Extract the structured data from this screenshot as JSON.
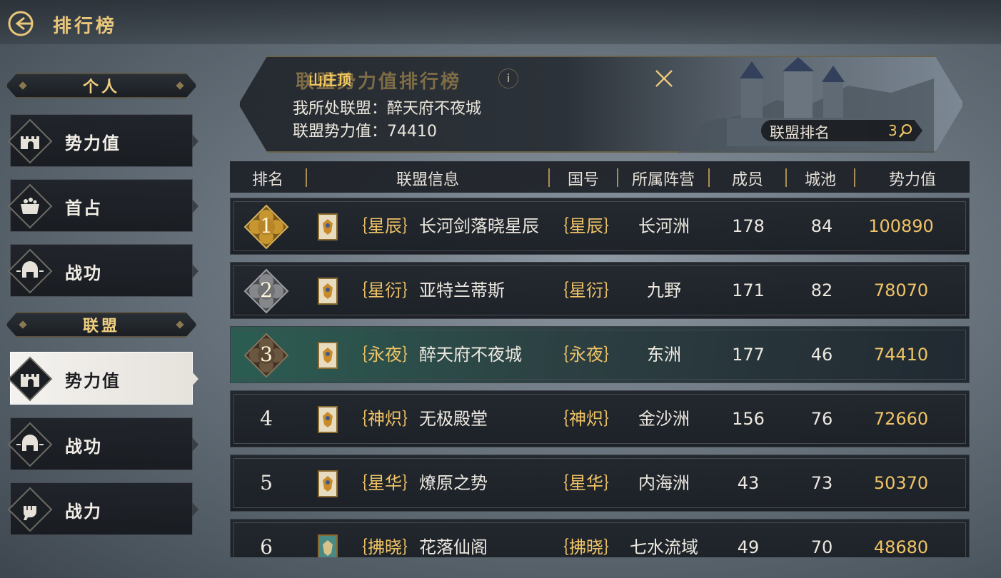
{
  "header": {
    "title": "排行榜",
    "back_icon": "back-arrow-icon"
  },
  "sidebar": {
    "personal_header": "个人",
    "personal_items": [
      {
        "label": "势力值",
        "icon": "castle-icon"
      },
      {
        "label": "首占",
        "icon": "cauldron-icon"
      },
      {
        "label": "战功",
        "icon": "helmet-icon"
      }
    ],
    "alliance_header": "联盟",
    "alliance_items": [
      {
        "label": "势力值",
        "icon": "castle-icon",
        "active": true
      },
      {
        "label": "战功",
        "icon": "helmet-icon"
      },
      {
        "label": "战力",
        "icon": "fist-icon"
      }
    ]
  },
  "banner": {
    "title": "联盟势力值排行榜",
    "server_tag": "山庄顶",
    "info_symbol": "i",
    "my_alliance_line": "我所处联盟：醉天府不夜城",
    "my_power_line": "联盟势力值：74410",
    "rank_label": "联盟排名",
    "rank_value": "3"
  },
  "table": {
    "headers": [
      "排名",
      "联盟信息",
      "国号",
      "所属阵营",
      "成员",
      "城池",
      "势力值"
    ],
    "rows": [
      {
        "rank": "1",
        "tag": "｛星辰｝",
        "name": "长河剑落晓星辰",
        "country": "｛星辰｝",
        "camp": "长河洲",
        "members": "178",
        "cities": "84",
        "power": "100890",
        "medal": "gold"
      },
      {
        "rank": "2",
        "tag": "｛星衍｝",
        "name": "亚特兰蒂斯",
        "country": "｛星衍｝",
        "camp": "九野",
        "members": "171",
        "cities": "82",
        "power": "78070",
        "medal": "silver"
      },
      {
        "rank": "3",
        "tag": "｛永夜｝",
        "name": "醉天府不夜城",
        "country": "｛永夜｝",
        "camp": "东洲",
        "members": "177",
        "cities": "46",
        "power": "74410",
        "medal": "bronze",
        "mine": true
      },
      {
        "rank": "4",
        "tag": "｛神炽｝",
        "name": "无极殿堂",
        "country": "｛神炽｝",
        "camp": "金沙洲",
        "members": "156",
        "cities": "76",
        "power": "72660"
      },
      {
        "rank": "5",
        "tag": "｛星华｝",
        "name": "燎原之势",
        "country": "｛星华｝",
        "camp": "内海洲",
        "members": "43",
        "cities": "73",
        "power": "50370"
      },
      {
        "rank": "6",
        "tag": "｛拂晓｝",
        "name": "花落仙阁",
        "country": "｛拂晓｝",
        "camp": "七水流域",
        "members": "49",
        "cities": "70",
        "power": "48680",
        "flag": "teal"
      }
    ]
  },
  "colors": {
    "gold_text": "#f0c466",
    "title_gold": "#e9c67a",
    "highlight_row": "#285c50"
  }
}
